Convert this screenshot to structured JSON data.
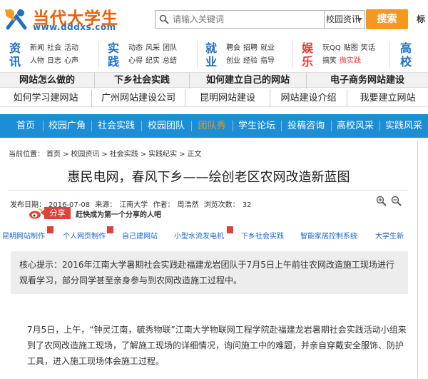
{
  "header": {
    "logo_text": "当代大学生",
    "logo_url": "www.dddxs.com",
    "search_placeholder": "请输入关键词",
    "search_scope": "校园资讯",
    "search_button": "搜索",
    "extra_link": "标",
    "colors": {
      "brand_orange": "#e95f0c",
      "brand_blue": "#1f6fc1",
      "button": "#f39a1e"
    }
  },
  "categories": [
    {
      "title": "资讯",
      "color": "#1f6fc1",
      "links": [
        "新闻",
        "社会",
        "活动",
        "人物",
        "日志",
        "心声"
      ],
      "highlight": []
    },
    {
      "title": "实践",
      "color": "#1f6fc1",
      "links": [
        "动态",
        "风采",
        "团队",
        "心得",
        "纪实",
        "总结"
      ],
      "highlight": []
    },
    {
      "title": "就业",
      "color": "#1f6fc1",
      "links": [
        "聘会",
        "招聘",
        "就业",
        "创业",
        "经验",
        "指导"
      ],
      "highlight": []
    },
    {
      "title": "娱乐",
      "color": "#e4393c",
      "links": [
        "玩QQ",
        "贴图",
        "笑话",
        "搞笑",
        "微实践"
      ],
      "highlight": [
        "微实践"
      ]
    },
    {
      "title": "高校",
      "color": "#1f6fc1",
      "links": [],
      "highlight": []
    }
  ],
  "link_row1": [
    "网站怎么做的",
    "下乡社会实践",
    "如何建立自己的网站",
    "电子商务网站建设"
  ],
  "link_row2": [
    "如何学习建网站",
    "广州网站建设公司",
    "昆明网站建设",
    "网站建设介绍",
    "我要建立网站"
  ],
  "nav": {
    "items": [
      "首页",
      "校园广角",
      "社会实践",
      "校园团队",
      "团队秀",
      "学生论坛",
      "投稿咨询",
      "高校风采",
      "实践风采"
    ],
    "active": "团队秀",
    "colors": {
      "bar": "#1c8ed5",
      "active": "#f7931e"
    }
  },
  "breadcrumb": [
    "当前位置：",
    "首页",
    ">",
    "校园资讯",
    ">",
    "社会实践",
    ">",
    "实践纪实",
    ">",
    "正文"
  ],
  "article": {
    "title": "惠民电网，春风下乡——绘创老区农网改造新蓝图",
    "meta": {
      "date_label": "发布日期：",
      "date": "2016-07-08",
      "source_label": "来源：",
      "source": "江南大学",
      "author_label": "作者：",
      "author": "周浩然",
      "views_label": "浏览次数：",
      "views": "32"
    },
    "share_label": "分享",
    "share_tip": "赶快成为第一个分享的人吧",
    "ad_links": [
      "昆明网站制作",
      "个人网页制作",
      "自己建网站",
      "小型水流发电机",
      "下乡社会实践",
      "智能家居控制系统",
      "大学生新"
    ],
    "summary_label": "核心提示：",
    "summary": "2016年江南大学暑期社会实践赴福建龙岩团队于7月5日上午前往农网改造施工现场进行观看学习，部分同学甚至亲身参与到农网改造施工过程中。",
    "paragraph": "7月5日，上午，“钟灵江南，毓秀物联”江南大学物联网工程学院赴福建龙岩暑期社会实践活动小组来到了农网改造施工现场，了解施工现场的详细情况，询问施工中的难题，并亲自穿戴安全服饰、防护工具，进入施工现场体会施工过程。"
  },
  "icons": [
    "logo-mark-icon",
    "search-icon",
    "caret-down-icon",
    "zoom-in-icon",
    "zoom-out-icon",
    "weibo-icon"
  ]
}
